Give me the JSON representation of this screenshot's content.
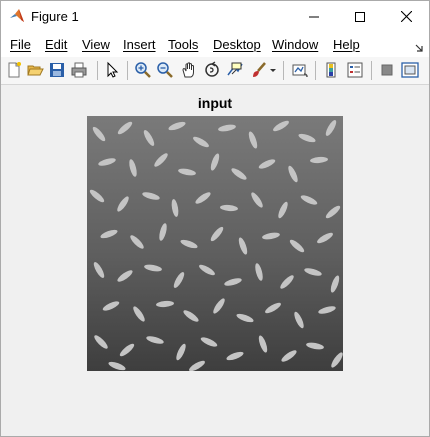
{
  "window": {
    "title": "Figure 1",
    "app_icon": "matlab-icon",
    "controls": [
      "minimize-icon",
      "maximize-icon",
      "close-icon"
    ]
  },
  "menu": {
    "items": [
      "File",
      "Edit",
      "View",
      "Insert",
      "Tools",
      "Desktop",
      "Window",
      "Help"
    ]
  },
  "toolbar": {
    "icons": [
      "new-figure-icon",
      "open-file-icon",
      "save-icon",
      "print-icon",
      "edit-plot-arrow-icon",
      "zoom-in-icon",
      "zoom-out-icon",
      "pan-hand-icon",
      "rotate-3d-icon",
      "data-cursor-icon",
      "brush-icon",
      "brush-dropdown-icon",
      "link-plot-icon",
      "colorbar-icon",
      "legend-icon",
      "hide-plot-tools-icon",
      "show-plot-tools-icon"
    ]
  },
  "figure": {
    "axes_title": "input",
    "image": "grayscale-rice-grains-image"
  },
  "colors": {
    "titlebar": "#ffffff",
    "menubar": "#ffffff",
    "figure_background": "#f0f0f0",
    "close_icon": "#000000"
  }
}
